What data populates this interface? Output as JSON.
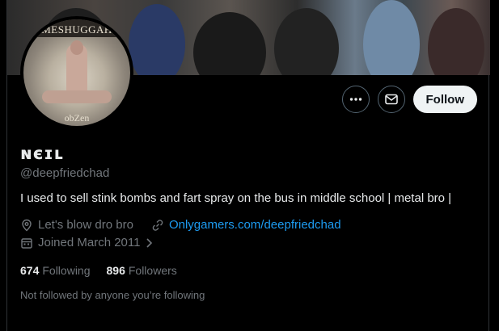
{
  "profile": {
    "display_name": "ɴєɪʟ",
    "handle": "@deepfriedchad",
    "bio": "I used to sell stink bombs and fart spray on the bus in middle school | metal bro |",
    "location": "Let's blow dro bro",
    "website": "Onlygamers.com/deepfriedchad",
    "joined": "Joined March 2011",
    "following_count": "674",
    "following_label": "Following",
    "followers_count": "896",
    "followers_label": "Followers",
    "not_followed_text": "Not followed by anyone you’re following"
  },
  "avatar": {
    "top_text": "MESHUGGAH",
    "bottom_text": "obZen"
  },
  "actions": {
    "follow_label": "Follow",
    "more_icon": "more-icon",
    "message_icon": "envelope-icon"
  },
  "colors": {
    "accent": "#1d9bf0",
    "background": "#000000",
    "muted": "#71767b",
    "follow_bg": "#eff3f4"
  }
}
